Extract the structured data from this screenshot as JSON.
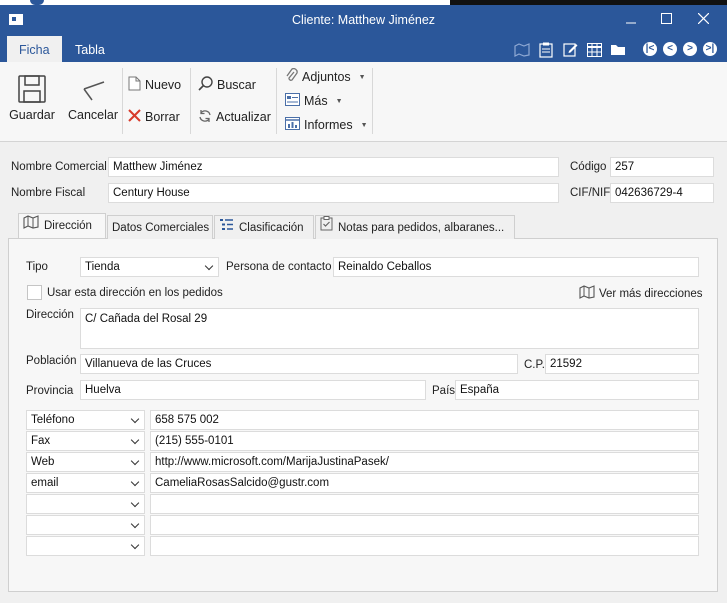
{
  "window": {
    "title": "Cliente: Matthew Jiménez"
  },
  "ribbon_tabs": [
    {
      "label": "Ficha"
    },
    {
      "label": "Tabla"
    }
  ],
  "ribbon": {
    "guardar": "Guardar",
    "cancelar": "Cancelar",
    "nuevo": "Nuevo",
    "borrar": "Borrar",
    "buscar": "Buscar",
    "actualizar": "Actualizar",
    "adjuntos": "Adjuntos",
    "mas": "Más",
    "informes": "Informes"
  },
  "header": {
    "nombre_comercial_label": "Nombre Comercial",
    "nombre_comercial": "Matthew Jiménez",
    "codigo_label": "Código",
    "codigo": "257",
    "nombre_fiscal_label": "Nombre Fiscal",
    "nombre_fiscal": "Century House",
    "cif_label": "CIF/NIF",
    "cif": "042636729-4"
  },
  "tabs": [
    {
      "label": "Dirección"
    },
    {
      "label": "Datos Comerciales"
    },
    {
      "label": "Clasificación"
    },
    {
      "label": "Notas para pedidos, albaranes..."
    }
  ],
  "direccion": {
    "tipo_label": "Tipo",
    "tipo": "Tienda",
    "contacto_label": "Persona de contacto",
    "contacto": "Reinaldo Ceballos",
    "usar_label": "Usar esta dirección en los pedidos",
    "ver_mas": "Ver más direcciones",
    "direccion_label": "Dirección",
    "direccion": "C/ Cañada del Rosal 29",
    "poblacion_label": "Población",
    "poblacion": "Villanueva de las Cruces",
    "cp_label": "C.P.",
    "cp": "21592",
    "provincia_label": "Provincia",
    "provincia": "Huelva",
    "pais_label": "País",
    "pais": "España",
    "contact_rows": [
      {
        "type": "Teléfono",
        "value": "658 575 002"
      },
      {
        "type": "Fax",
        "value": "(215) 555-0101"
      },
      {
        "type": "Web",
        "value": "http://www.microsoft.com/MarijaJustinaPasek/"
      },
      {
        "type": "email",
        "value": "CameliaRosasSalcido@gustr.com"
      },
      {
        "type": "",
        "value": ""
      },
      {
        "type": "",
        "value": ""
      },
      {
        "type": "",
        "value": ""
      }
    ]
  }
}
